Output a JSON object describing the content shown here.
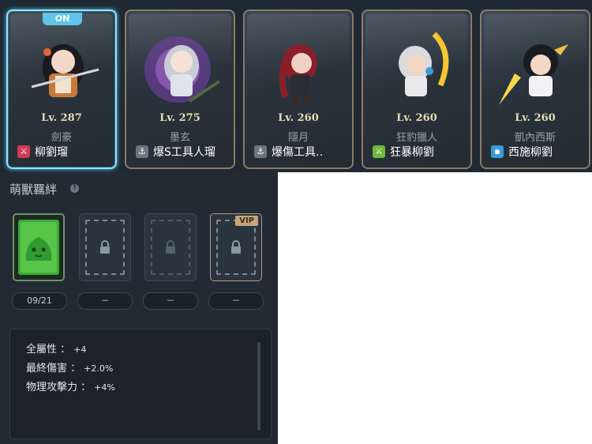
{
  "characters": [
    {
      "badge": "ON",
      "level": "Lv. 287",
      "job": "劍豪",
      "name": "柳劉瑠",
      "icon": "sword-icon",
      "icon_color": "#d23a55",
      "selected": true
    },
    {
      "badge": "",
      "level": "Lv. 275",
      "job": "墨玄",
      "name": "爆S工具人瑠",
      "icon": "anchor-icon",
      "icon_color": "#6b7680",
      "selected": false
    },
    {
      "badge": "",
      "level": "Lv. 260",
      "job": "隱月",
      "name": "爆傷工具‥",
      "icon": "anchor-icon",
      "icon_color": "#6b7680",
      "selected": false
    },
    {
      "badge": "",
      "level": "Lv. 260",
      "job": "狂豹獵人",
      "name": "狂暴柳劉",
      "icon": "sword-icon",
      "icon_color": "#6fb83e",
      "selected": false
    },
    {
      "badge": "",
      "level": "Lv. 260",
      "job": "凱內西斯",
      "name": "西施柳劉",
      "icon": "book-icon",
      "icon_color": "#3c9bd6",
      "selected": false
    }
  ],
  "bond": {
    "title": "萌獸羈絆",
    "slots": [
      {
        "state": "active",
        "pill": "09/21"
      },
      {
        "state": "locked",
        "pill": "－"
      },
      {
        "state": "locked-dim",
        "pill": "－"
      },
      {
        "state": "vip",
        "tag": "VIP",
        "pill": "－"
      }
    ],
    "stats": [
      {
        "label": "全屬性 ：",
        "value": "+4"
      },
      {
        "label": "最終傷害 ：",
        "value": "+2.0%"
      },
      {
        "label": "物理攻擊力 ：",
        "value": "+4%"
      }
    ]
  },
  "colors": {
    "selected_border": "#8fe3ff",
    "badge": "#5fc4e8",
    "gold_border": "#8a7b63",
    "vip": "#c9a67a"
  }
}
